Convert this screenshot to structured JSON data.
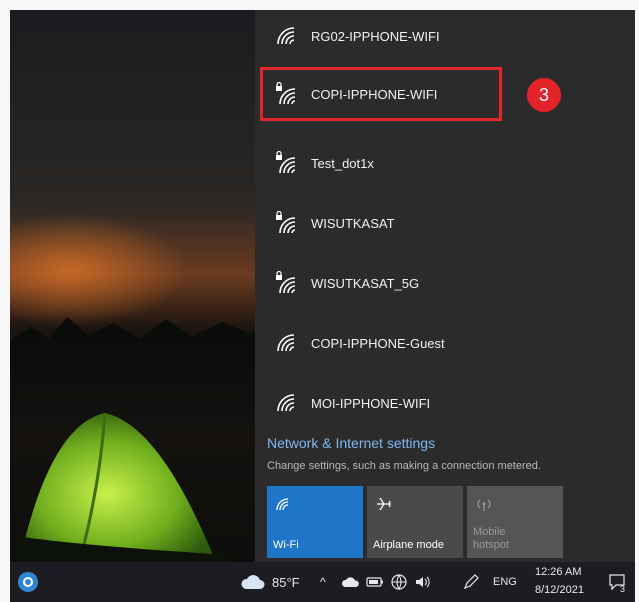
{
  "networks": [
    {
      "ssid": "RG02-IPPHONE-WIFI",
      "secured": false
    },
    {
      "ssid": "COPI-IPPHONE-WIFI",
      "secured": true
    },
    {
      "ssid": "Test_dot1x",
      "secured": true
    },
    {
      "ssid": "WISUTKASAT",
      "secured": true
    },
    {
      "ssid": "WISUTKASAT_5G",
      "secured": true
    },
    {
      "ssid": "COPI-IPPHONE-Guest",
      "secured": false
    },
    {
      "ssid": "MOI-IPPHONE-WIFI",
      "secured": false
    }
  ],
  "annotation": {
    "step_number": "3",
    "color": "#e2232a"
  },
  "settings": {
    "link_label": "Network & Internet settings",
    "description": "Change settings, such as making a connection metered."
  },
  "quick_actions": {
    "wifi": {
      "label": "Wi-Fi",
      "active": true
    },
    "airplane": {
      "label": "Airplane mode",
      "active": false
    },
    "hotspot": {
      "label_line1": "Mobile",
      "label_line2": "hotspot",
      "disabled": true
    }
  },
  "taskbar": {
    "weather": "85°F",
    "language": "ENG",
    "time": "12:26 AM",
    "date": "8/12/2021",
    "notification_count": "3"
  },
  "colors": {
    "accent": "#1f76c9",
    "flyout_bg": "#2b2b2b",
    "link": "#7fb8f0"
  }
}
